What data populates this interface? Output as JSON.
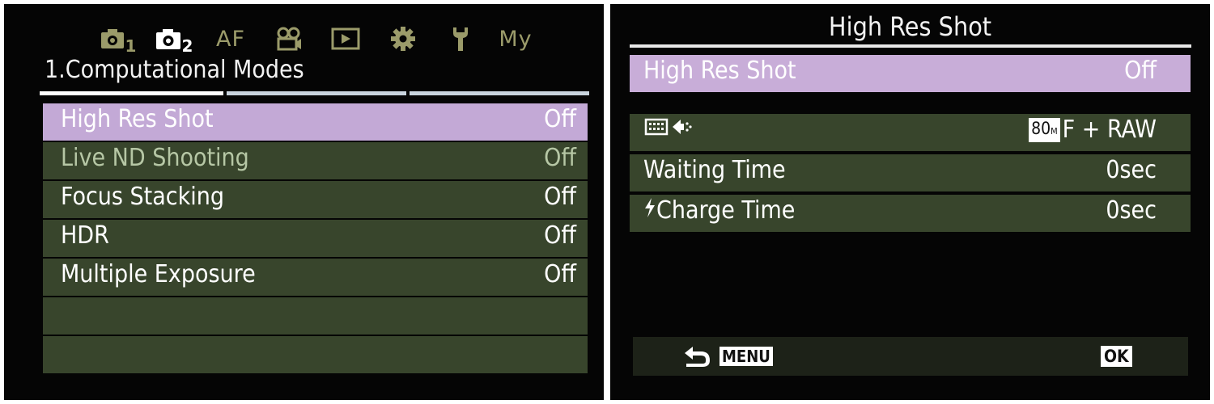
{
  "colors": {
    "row_bg": "#38452c",
    "selected_bg": "#c3a9d6",
    "tab_active": "#ffffff",
    "tab_inactive": "#9b9b6a",
    "screen_bg": "#050505"
  },
  "left": {
    "tabs": [
      {
        "icon": "camera1-icon",
        "sub": "1",
        "active": false
      },
      {
        "icon": "camera2-icon",
        "sub": "2",
        "active": true
      },
      {
        "text": "AF"
      },
      {
        "icon": "movie-camera-icon"
      },
      {
        "icon": "playback-icon"
      },
      {
        "icon": "gear-icon"
      },
      {
        "icon": "wrench-icon"
      },
      {
        "text": "My"
      }
    ],
    "section_title": "1.Computational Modes",
    "items": [
      {
        "label": "High Res Shot",
        "value": "Off",
        "selected": true
      },
      {
        "label": "Live ND Shooting",
        "value": "Off",
        "dimmed": true
      },
      {
        "label": "Focus Stacking",
        "value": "Off"
      },
      {
        "label": "HDR",
        "value": "Off"
      },
      {
        "label": "Multiple Exposure",
        "value": "Off"
      },
      {
        "label": "",
        "value": ""
      },
      {
        "label": "",
        "value": ""
      }
    ]
  },
  "right": {
    "title": "High Res Shot",
    "header_row": {
      "label": "High Res Shot",
      "value": "Off"
    },
    "settings": [
      {
        "icon": "tripod-highres-icon",
        "label": "",
        "badge": "80",
        "badge_sub": "M",
        "value": "F + RAW"
      },
      {
        "label": "Waiting Time",
        "value": "0sec"
      },
      {
        "icon": "flash-icon",
        "label": "Charge Time",
        "value": "0sec"
      }
    ],
    "footer": {
      "back_icon": "back-arrow-icon",
      "menu_label": "MENU",
      "ok_label": "OK"
    }
  }
}
